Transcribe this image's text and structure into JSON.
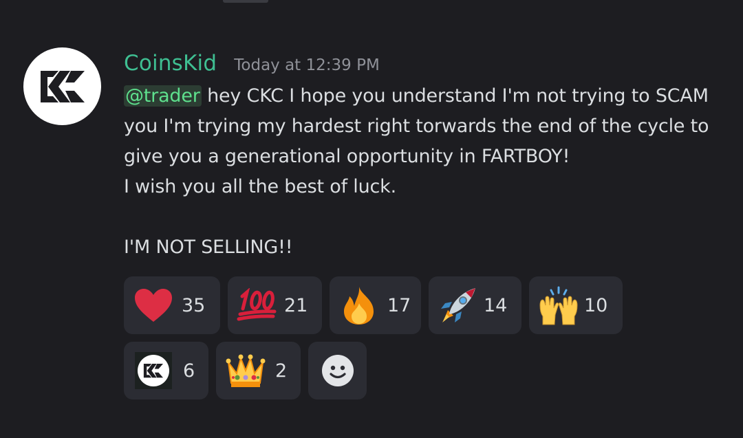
{
  "message": {
    "author": "CoinsKid",
    "author_color": "#3fbf92",
    "timestamp": "Today at 12:39 PM",
    "mention": "@trader",
    "lines": [
      " hey CKC I hope you understand I'm not trying to SCAM",
      "you I'm trying my hardest right torwards the end of the cycle to",
      "give you a generational opportunity in FARTBOY!",
      "I wish you all the best of luck.",
      "I'M NOT SELLING!!"
    ]
  },
  "reactions": [
    {
      "emoji": "red-heart",
      "count": "35"
    },
    {
      "emoji": "hundred-points",
      "count": "21"
    },
    {
      "emoji": "fire",
      "count": "17"
    },
    {
      "emoji": "rocket",
      "count": "14"
    },
    {
      "emoji": "raising-hands",
      "count": "10"
    },
    {
      "emoji": "ckc-logo",
      "count": "6"
    },
    {
      "emoji": "crown",
      "count": "2"
    }
  ],
  "add_reaction": {
    "icon": "smiley-add-reaction"
  }
}
